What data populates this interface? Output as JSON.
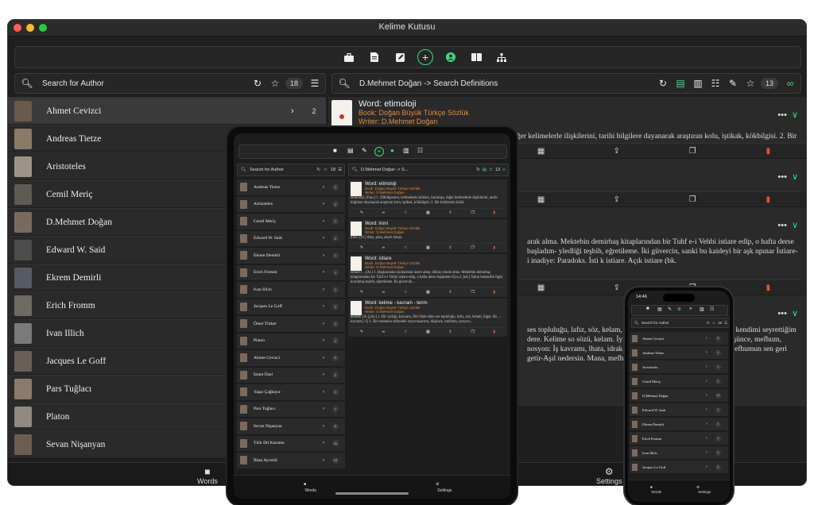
{
  "app": {
    "title": "Kelime Kutusu"
  },
  "toolbar": {
    "icons": [
      "briefcase-icon",
      "document-icon",
      "edit-icon",
      "plus-icon",
      "user-icon",
      "book-icon",
      "hierarchy-icon"
    ]
  },
  "left_search": {
    "label": "Search for Author",
    "count": "18"
  },
  "right_search": {
    "label": "D.Mehmet Doğan -> Search Definitions",
    "count": "13"
  },
  "authors": [
    {
      "name": "Ahmet Cevizci",
      "count": "2",
      "color": "#6b5a4a"
    },
    {
      "name": "Andreas Tietze",
      "count": "",
      "color": "#8a7a66"
    },
    {
      "name": "Aristoteles",
      "count": "",
      "color": "#9c9487"
    },
    {
      "name": "Cemil Meriç",
      "count": "",
      "color": "#5e5a55"
    },
    {
      "name": "D.Mehmet Doğan",
      "count": "",
      "color": "#7a6a5e"
    },
    {
      "name": "Edward W. Said",
      "count": "",
      "color": "#4d4d4d"
    },
    {
      "name": "Ekrem Demirli",
      "count": "",
      "color": "#555b63"
    },
    {
      "name": "Erich Fromm",
      "count": "",
      "color": "#6e6a66"
    },
    {
      "name": "Ivan Illich",
      "count": "",
      "color": "#7a7a7a"
    },
    {
      "name": "Jacques Le Goff",
      "count": "",
      "color": "#6a5f58"
    },
    {
      "name": "Pars Tuğlacı",
      "count": "",
      "color": "#8c7b6a"
    },
    {
      "name": "Platon",
      "count": "",
      "color": "#8e8a80"
    },
    {
      "name": "Sevan Nişanyan",
      "count": "",
      "color": "#6d5d50"
    }
  ],
  "definitions": [
    {
      "word": "Word: etimoloji",
      "book": "Book: Doğan Büyük Türkçe Sözlük",
      "writer": "Writer: D.Mehmet Doğan",
      "text": "u, diğer kelimelerle ilişkilerini, tarihi bilgilere dayanarak araştıran kolu, iştikak, kökbilgisi. 2. Bir"
    },
    {
      "word": "",
      "book": "",
      "writer": "",
      "text": ""
    },
    {
      "word": "",
      "book": "",
      "writer": "",
      "text": "arak alma. Mektebin demirbaş kitaplarından bir Tuhf e-i Vehbi istiare edip, o hafta derse başladım- yledliği teşbih, eğretileme. İki güvercin, sanki bu kaideyi bir aşk npınar İstiare-i inadiye: Paradoks. İsti k istiare. Açık istiare (bk."
    },
    {
      "word": "",
      "book": "",
      "writer": "",
      "text": "ses topluluğu, lafız, söz, kelam, lügat. H l 2. Bir mana ifade eden ne, kendimi seyrettiğim dere. Kelime so sözü, kelam. İyice düşün meler yardımıyla-Cahit düşünce, mefhum, nosyon: İş kavramı, lhata, idrak, anlayış, kavrama gücü. Tez yazıp mefhumun sen geri getir-Aşıl nedersin. Mana, mefhum"
    }
  ],
  "tabbar": {
    "words": "Words",
    "settings": "Settings"
  },
  "tablet": {
    "search_author": "Search for Author",
    "count": "18",
    "search_defs": "D.Mehmet Doğan -> S...",
    "defs_count": "13",
    "authors": [
      {
        "name": "Andreas Tietze",
        "count": "1"
      },
      {
        "name": "Aristoteles",
        "count": "1"
      },
      {
        "name": "Cemil Meriç",
        "count": "1"
      },
      {
        "name": "Edward W. Said",
        "count": "1"
      },
      {
        "name": "Ekrem Demirli",
        "count": "1"
      },
      {
        "name": "Erich Fromm",
        "count": "1"
      },
      {
        "name": "Ivan Illich",
        "count": "1"
      },
      {
        "name": "Jacques Le Goff",
        "count": "1"
      },
      {
        "name": "Ömer Türker",
        "count": "1"
      },
      {
        "name": "Platon",
        "count": "1"
      },
      {
        "name": "Ahmet Cevizci",
        "count": "2"
      },
      {
        "name": "İsmet Özel",
        "count": "2"
      },
      {
        "name": "Yaşar Çağbayır",
        "count": "3"
      },
      {
        "name": "Pars Tuğlacı",
        "count": "7"
      },
      {
        "name": "Sevan Nişanyan",
        "count": "9"
      },
      {
        "name": "Türk Dil Kurumu",
        "count": "11"
      },
      {
        "name": "İlhan Ayverdi",
        "count": "12"
      }
    ],
    "defs": [
      {
        "word": "Word: etimoloji",
        "book": "Book: Doğan Büyük Türkçe Sözlük",
        "writer": "Writer: D.Mehmet Doğan",
        "text": "etimoloji. [Fası.] 1. Dilbilgisinin, kelimelerin kökleri, kuruluşu, diğer kelimelerle ilişkilerini, tarihi bilgilere dayanarak araştıran kolu, iştikak, kökbilgisi. 2. Bir kelimenin kökü."
      },
      {
        "word": "Word: ironi",
        "book": "Book: Doğan Büyük Türkçe Sözlük",
        "writer": "Writer: D.Mehmet Doğan",
        "text": "ironi. [Fr.] Alay, şaka, alaylı istiap."
      },
      {
        "word": "Word: istiare",
        "book": "Book: Doğan Büyük Türkçe Sözlük",
        "writer": "Writer: D.Mehmet Doğan",
        "text": "İstiare ( ...(Ar.) 1. Başkasından kullanmak üzere alma, ödünç olarak alma. Mektebin demirbaş kitaplarından bir Tuhf e-i Vehbi istiare edip, o hafta derse başladım-Ziya 2. [ed.] Yakın benzerlik ilgisi kurulmuş teşbih, eğretileme. İki güvercin..."
      },
      {
        "word": "Word: kelime - kavram - terim",
        "book": "Book: Doğan Büyük Türkçe Sözlük",
        "writer": "Writer: D.Mehmet Doğan",
        "text": "kelime. [A.],[Ar.] 1. Bir varlığı, kavramı, fiili ifade eden ses topluluğu, lafız, söz, kelam, lügat. Hz ... kavram [-1] 1. Bir nesnenin zihindeki soyut tasarımı, düşünce, mefhum, nosyon..."
      }
    ],
    "tab_words": "Words",
    "tab_settings": "Settings"
  },
  "phone": {
    "time": "14:46",
    "search_author": "Search for Author",
    "count": "18",
    "authors": [
      {
        "name": "Ahmet Cevizci",
        "count": "2"
      },
      {
        "name": "Andreas Tietze",
        "count": "1"
      },
      {
        "name": "Aristoteles",
        "count": "1"
      },
      {
        "name": "Cemil Meriç",
        "count": "1"
      },
      {
        "name": "D.Mehmet Doğan",
        "count": "13"
      },
      {
        "name": "Edward W. Said",
        "count": "1"
      },
      {
        "name": "Ekrem Demirli",
        "count": "1"
      },
      {
        "name": "Erich Fromm",
        "count": "1"
      },
      {
        "name": "Ivan Illich",
        "count": "1"
      },
      {
        "name": "Jacques Le Goff",
        "count": "1"
      }
    ],
    "tab_words": "Words",
    "tab_settings": "Settings"
  }
}
